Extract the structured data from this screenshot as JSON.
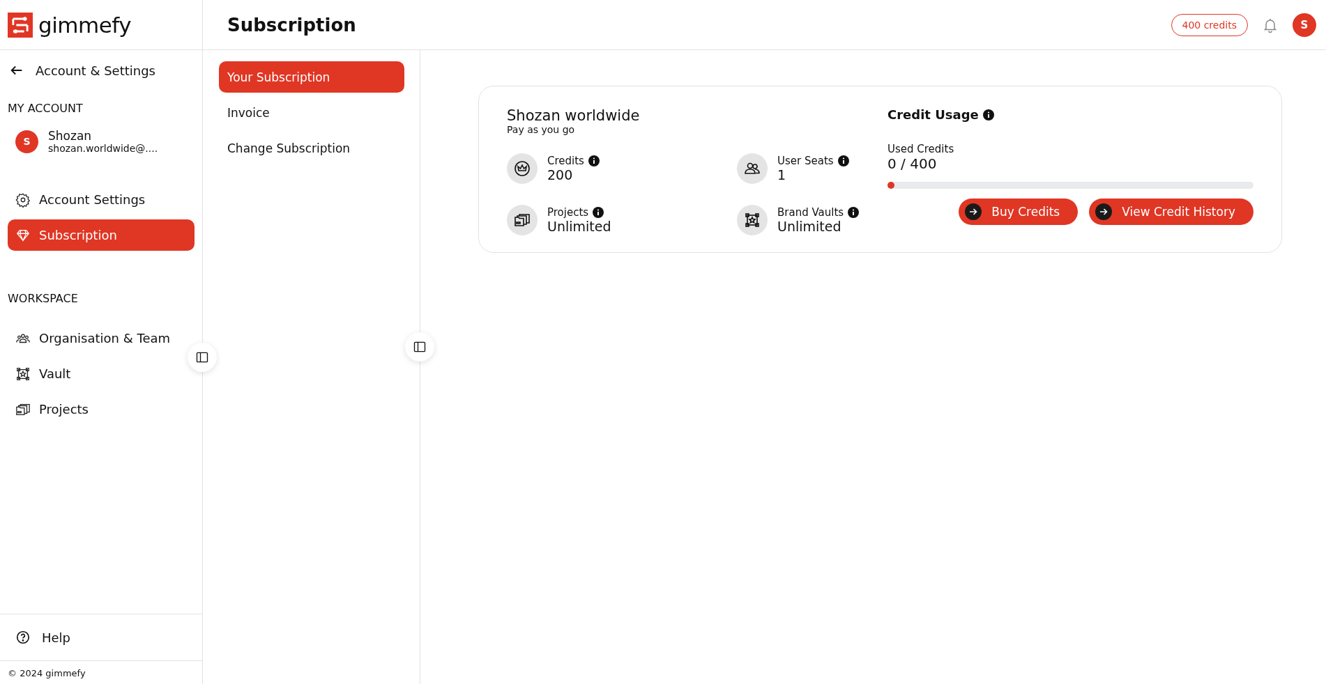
{
  "logo": {
    "text": "gimmefy"
  },
  "sidebar": {
    "back_label": "Account & Settings",
    "sections": [
      {
        "heading": "MY ACCOUNT",
        "user": {
          "initial": "S",
          "name": "Shozan",
          "email": "shozan.worldwide@...."
        },
        "items": [
          {
            "label": "Account Settings",
            "kind": "gear",
            "selected": false
          },
          {
            "label": "Subscription",
            "kind": "diamond",
            "selected": true
          }
        ]
      },
      {
        "heading": "WORKSPACE",
        "items": [
          {
            "label": "Organisation & Team",
            "kind": "team",
            "selected": false
          },
          {
            "label": "Vault",
            "kind": "vault",
            "selected": false
          },
          {
            "label": "Projects",
            "kind": "folders",
            "selected": false
          }
        ]
      }
    ],
    "help": "Help",
    "footer": "© 2024 gimmefy"
  },
  "header": {
    "title": "Subscription",
    "credits_badge": "400 credits",
    "avatar_initial": "S"
  },
  "subnav": [
    {
      "label": "Your Subscription",
      "selected": true
    },
    {
      "label": "Invoice",
      "selected": false
    },
    {
      "label": "Change Subscription",
      "selected": false
    }
  ],
  "card": {
    "name": "Shozan worldwide",
    "plan": "Pay as you go",
    "stats": [
      {
        "label": "Credits",
        "value": "200",
        "kind": "crown"
      },
      {
        "label": "User Seats",
        "value": "1",
        "kind": "users"
      },
      {
        "label": "Projects",
        "value": "Unlimited",
        "kind": "folders"
      },
      {
        "label": "Brand Vaults",
        "value": "Unlimited",
        "kind": "vault"
      }
    ],
    "usage": {
      "title": "Credit Usage",
      "label": "Used Credits",
      "reading": "0 / 400",
      "level": 0
    },
    "buttons": [
      "Buy Credits",
      "View Credit History"
    ]
  }
}
